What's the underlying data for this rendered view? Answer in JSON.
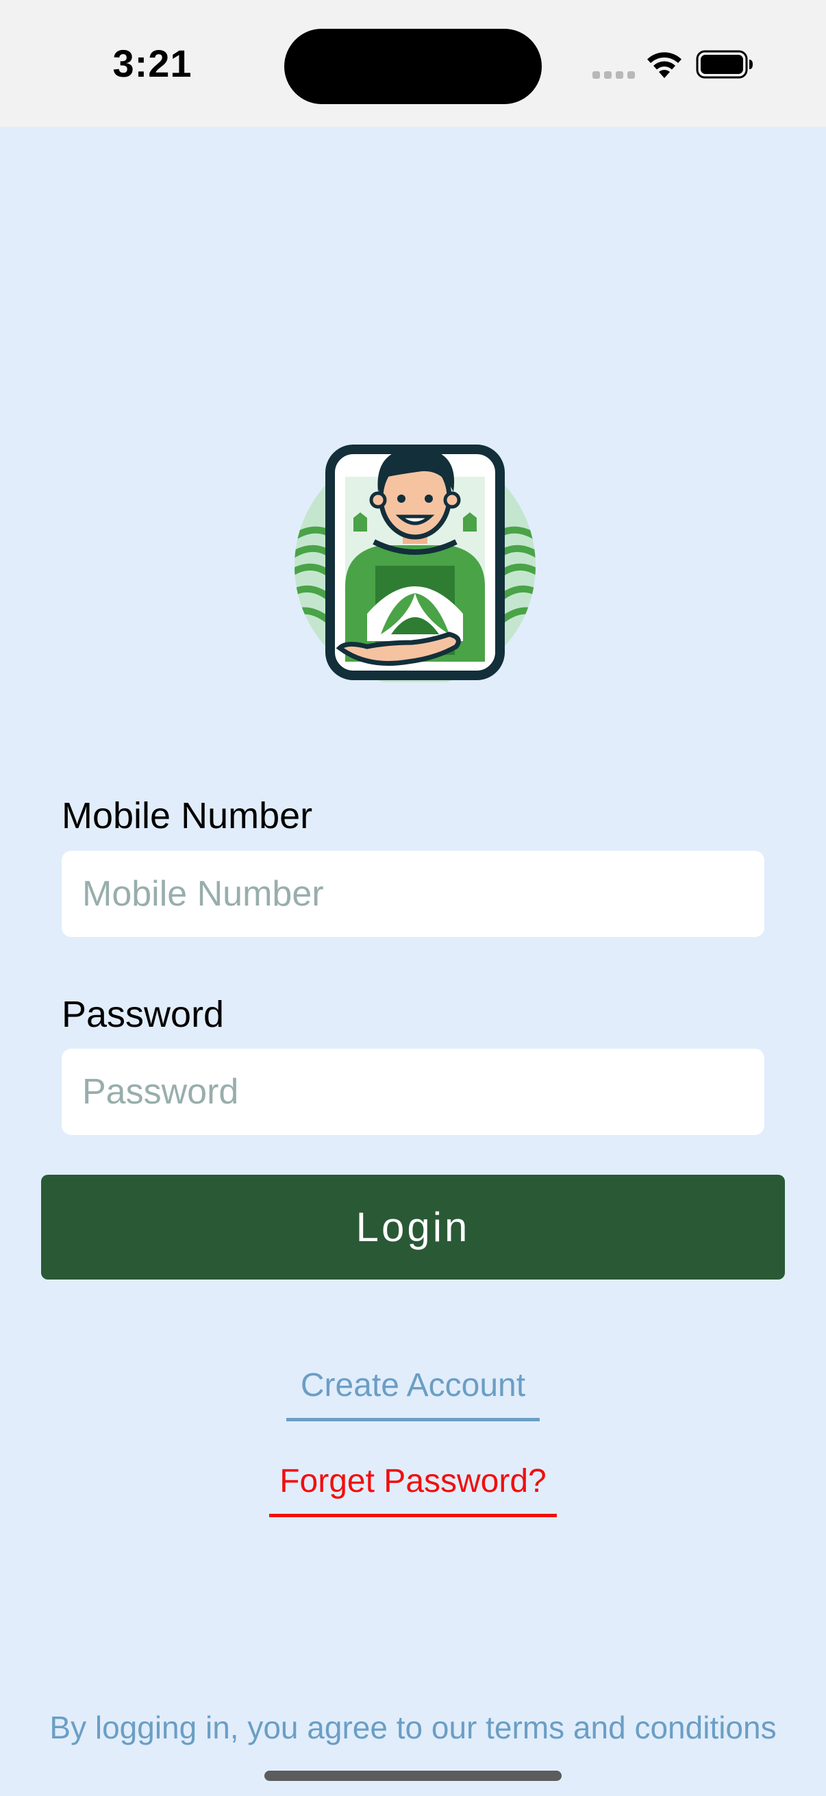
{
  "status_bar": {
    "time": "3:21"
  },
  "logo": {
    "icon": "farmer-logo-icon"
  },
  "form": {
    "mobile_label": "Mobile Number",
    "mobile_placeholder": "Mobile Number",
    "mobile_value": "",
    "password_label": "Password",
    "password_placeholder": "Password",
    "password_value": "",
    "login_label": "Login"
  },
  "links": {
    "create_account": "Create Account",
    "forget_password": "Forget Password?"
  },
  "footer": {
    "terms": "By logging in, you agree to our terms and conditions"
  },
  "colors": {
    "background": "#e1edfb",
    "primary_button": "#2a5936",
    "link_blue": "#6b9ec4",
    "link_red": "#f20e0e",
    "placeholder": "#98aeac"
  }
}
